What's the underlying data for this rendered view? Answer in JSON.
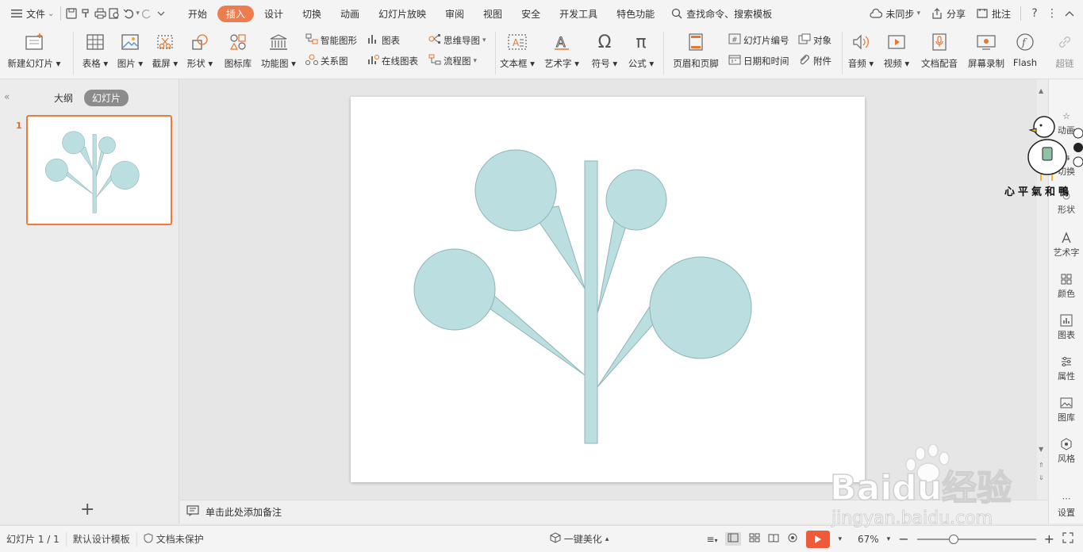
{
  "topbar": {
    "file_menu": "文件",
    "menu_tabs": [
      "开始",
      "插入",
      "设计",
      "切换",
      "动画",
      "幻灯片放映",
      "审阅",
      "视图",
      "安全",
      "开发工具",
      "特色功能"
    ],
    "active_tab": "插入",
    "search": "查找命令、搜索模板",
    "sync": "未同步",
    "share": "分享",
    "comment": "批注"
  },
  "ribbon": {
    "new_slide": "新建幻灯片",
    "table": "表格",
    "picture": "图片",
    "screenshot": "截屏",
    "shape": "形状",
    "icon_lib": "图标库",
    "function_chart": "功能图",
    "smart_art": "智能图形",
    "chart": "图表",
    "relation": "关系图",
    "online_chart": "在线图表",
    "mindmap": "思维导图",
    "flowchart": "流程图",
    "textbox": "文本框",
    "wordart": "艺术字",
    "symbol": "符号",
    "formula": "公式",
    "header_footer": "页眉和页脚",
    "slide_number": "幻灯片编号",
    "object": "对象",
    "datetime": "日期和时间",
    "attachment": "附件",
    "audio": "音频",
    "video": "视频",
    "doc_audio": "文档配音",
    "screen_record": "屏幕录制",
    "flash": "Flash",
    "hyperlink": "超链"
  },
  "left_panel": {
    "outline_tab": "大纲",
    "slides_tab": "幻灯片",
    "slide_number": "1"
  },
  "right_sidebar": {
    "items": [
      "动画",
      "切换",
      "形状",
      "艺术字",
      "颜色",
      "图表",
      "属性",
      "图库",
      "风格",
      "设置"
    ]
  },
  "notes": {
    "placeholder": "单击此处添加备注"
  },
  "statusbar": {
    "slide_info": "幻灯片 1 / 1",
    "template": "默认设计模板",
    "protection": "文档未保护",
    "beautify": "一键美化",
    "zoom": "67%"
  },
  "slide": {
    "shape_fill": "#bbdfe1",
    "shape_stroke": "#8fb4b6",
    "accent": "#ed7d4f"
  },
  "watermark": {
    "text": "Baidu经验",
    "url": "jingyan.baidu.com",
    "mascot_caption": "心平氣和鴨"
  }
}
